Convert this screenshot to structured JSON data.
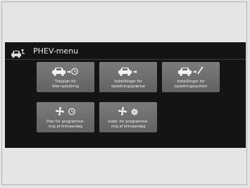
{
  "header": {
    "title": "PHEV-menu",
    "icon": "car-plug-icon"
  },
  "tiles": [
    {
      "icon": "car-plug-clock-icon",
      "label_line1": "Tidsplan for",
      "label_line2": "ikke-opladning"
    },
    {
      "icon": "car-plug-icon",
      "label_line1": "Indstillinger for",
      "label_line2": "opladningsgrænse"
    },
    {
      "icon": "car-charging-system-icon",
      "label_line1": "Indstillinger for",
      "label_line2": "opladningssystem"
    },
    {
      "icon": "fan-clock-icon",
      "label_line1": "Plan for programme-",
      "label_line2": "ring af klimaanlæg"
    },
    {
      "icon": "fan-gear-icon",
      "label_line1": "Indst. for programme-",
      "label_line2": "ring af klimaanlæg"
    }
  ]
}
